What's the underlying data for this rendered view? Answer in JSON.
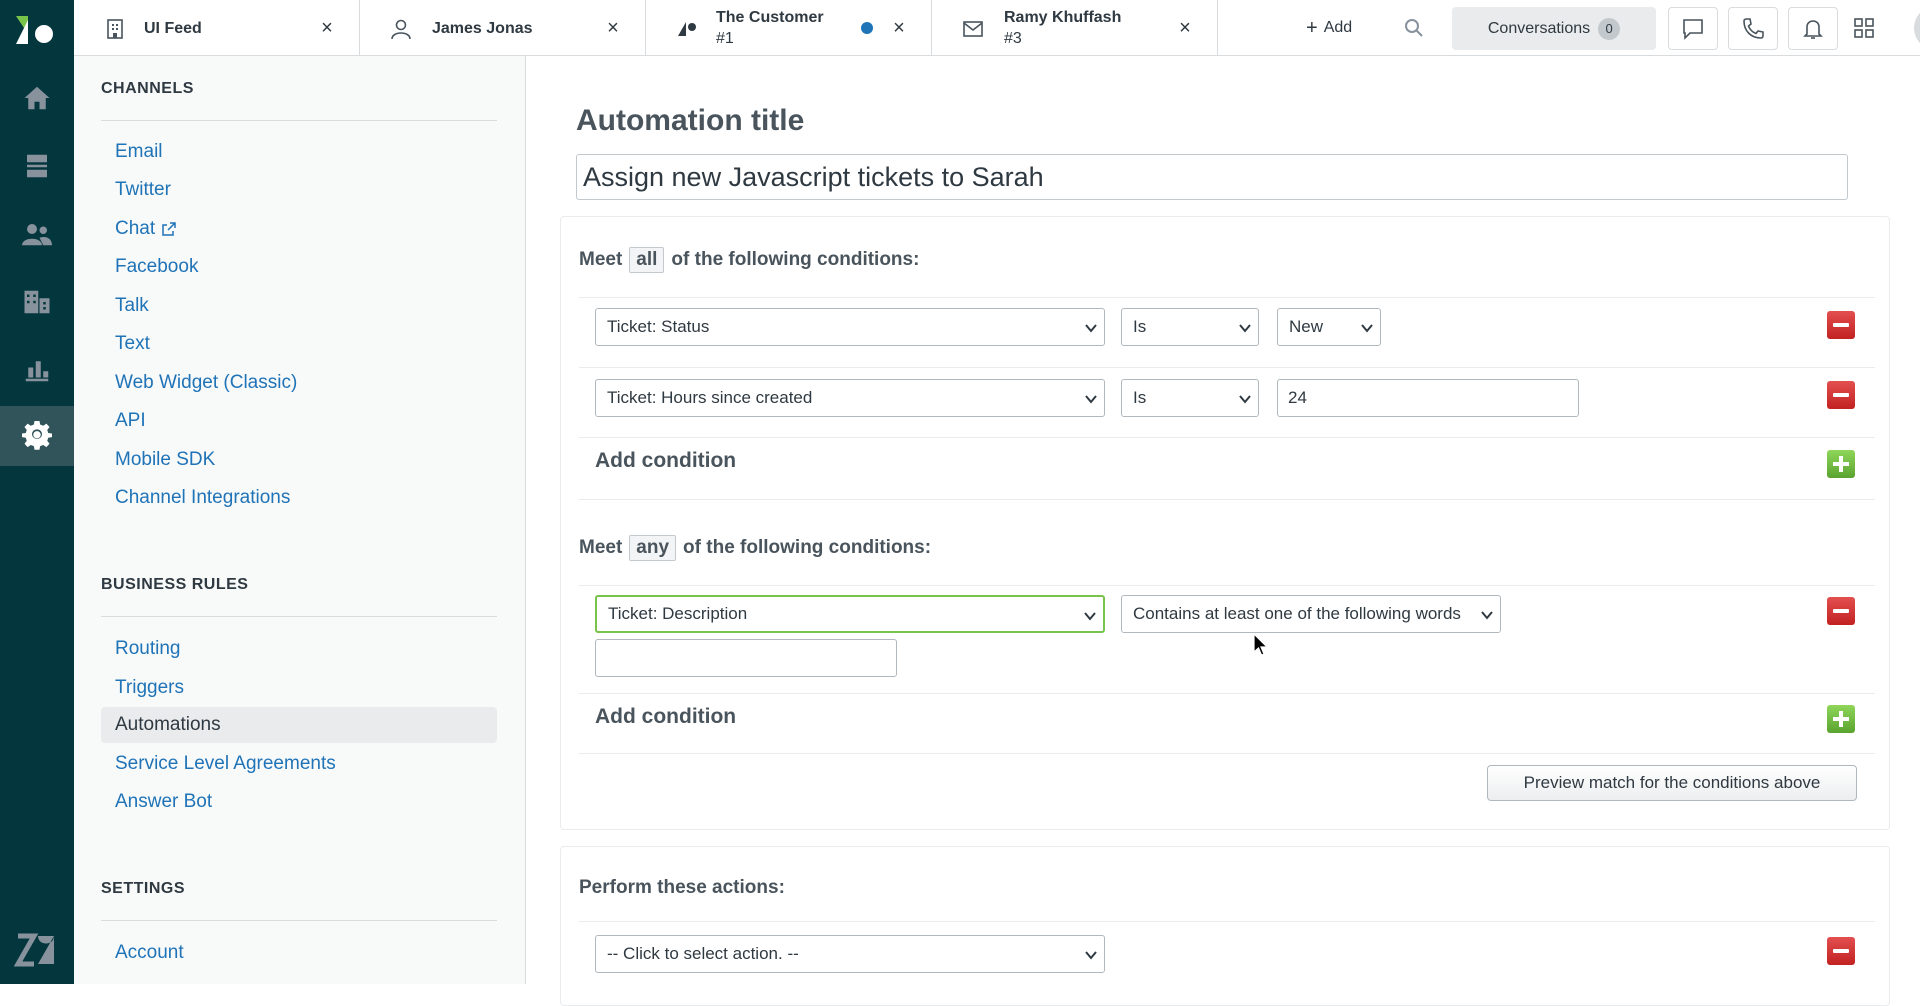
{
  "tabs": [
    {
      "title": "UI Feed",
      "sub": "",
      "icon": "building-icon"
    },
    {
      "title": "James Jonas",
      "sub": "",
      "icon": "user-icon"
    },
    {
      "title": "The Customer",
      "sub": "#1",
      "icon": "zendesk-ticket-icon"
    },
    {
      "title": "Ramy Khuffash",
      "sub": "#3",
      "icon": "mail-icon"
    }
  ],
  "topbar": {
    "add_label": "Add",
    "conversations_label": "Conversations",
    "conversations_count": "0"
  },
  "sidebar": {
    "channels_heading": "CHANNELS",
    "channels": [
      "Email",
      "Twitter",
      "Chat",
      "Facebook",
      "Talk",
      "Text",
      "Web Widget (Classic)",
      "API",
      "Mobile SDK",
      "Channel Integrations"
    ],
    "business_heading": "BUSINESS RULES",
    "business": [
      "Routing",
      "Triggers",
      "Automations",
      "Service Level Agreements",
      "Answer Bot"
    ],
    "settings_heading": "SETTINGS",
    "settings": [
      "Account"
    ]
  },
  "main": {
    "title_label": "Automation title",
    "title_value": "Assign new Javascript tickets to Sarah",
    "all": {
      "prefix": "Meet",
      "keyword": "all",
      "suffix": "of the following conditions:",
      "rows": [
        {
          "field": "Ticket: Status",
          "operator": "Is",
          "value": "New"
        },
        {
          "field": "Ticket: Hours since created",
          "operator": "Is",
          "value": "24"
        }
      ],
      "add_label": "Add condition"
    },
    "any": {
      "prefix": "Meet",
      "keyword": "any",
      "suffix": "of the following conditions:",
      "rows": [
        {
          "field": "Ticket: Description",
          "operator": "Contains at least one of the following words",
          "value": ""
        }
      ],
      "add_label": "Add condition"
    },
    "preview_label": "Preview match for the conditions above",
    "actions": {
      "heading": "Perform these actions:",
      "select_placeholder": "-- Click to select action. --"
    }
  },
  "colors": {
    "rail": "#03363d",
    "link": "#1f73b7",
    "focus": "#78c349",
    "remove": "#d93f3f",
    "add": "#78c349"
  }
}
